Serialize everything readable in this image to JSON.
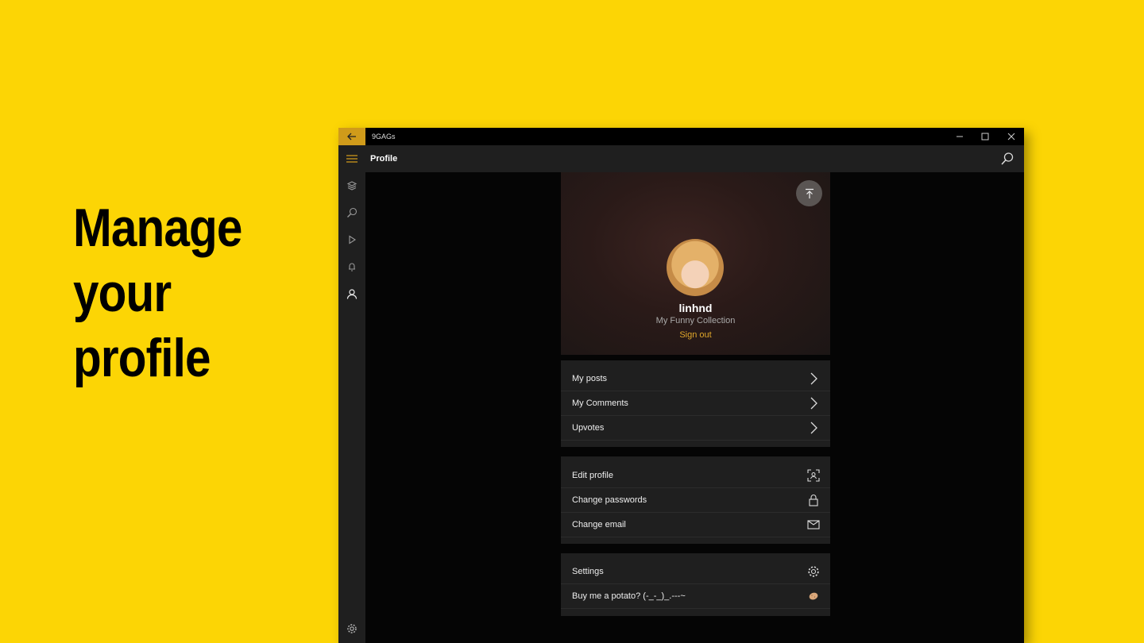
{
  "headline": [
    "Manage",
    "your",
    "profile"
  ],
  "window": {
    "title": "9GAGs",
    "page_title": "Profile"
  },
  "profile": {
    "username": "linhnd",
    "collection": "My Funny Collection",
    "sign_out": "Sign out"
  },
  "groups": [
    {
      "items": [
        {
          "label": "My posts",
          "icon": "chevron-right-icon"
        },
        {
          "label": "My Comments",
          "icon": "chevron-right-icon"
        },
        {
          "label": "Upvotes",
          "icon": "chevron-right-icon"
        }
      ]
    },
    {
      "items": [
        {
          "label": "Edit profile",
          "icon": "face-scan-icon"
        },
        {
          "label": "Change passwords",
          "icon": "lock-icon"
        },
        {
          "label": "Change email",
          "icon": "mail-icon"
        }
      ]
    },
    {
      "items": [
        {
          "label": "Settings",
          "icon": "gear-icon"
        },
        {
          "label": "Buy me a potato? (-_-_)_.---~",
          "icon": "potato-icon"
        }
      ]
    }
  ],
  "colors": {
    "background": "#FCD505",
    "accent": "#D09B1A",
    "sign_out": "#E0A72A",
    "panel": "#1F1F1F"
  }
}
